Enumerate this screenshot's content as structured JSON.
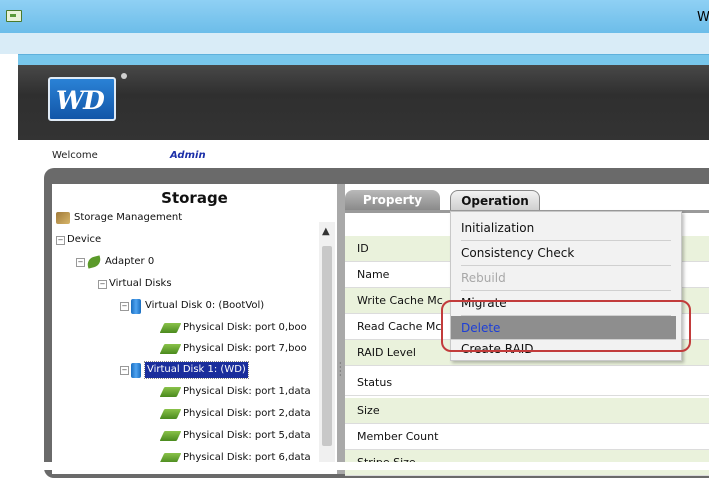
{
  "window": {
    "title": "W"
  },
  "brand": {
    "logo_text": "WD"
  },
  "welcome": {
    "label": "Welcome",
    "user": "Admin"
  },
  "storage": {
    "title": "Storage",
    "tree": [
      {
        "label": "Storage Management",
        "icon": "storage-management-icon"
      },
      {
        "label": "Device",
        "expander": "-"
      },
      {
        "label": "Adapter 0",
        "icon": "adapter-icon",
        "expander": "-"
      },
      {
        "label": "Virtual Disks"
      },
      {
        "label": "Virtual Disk 0: (BootVol)",
        "icon": "virtual-disk-icon",
        "expander": "-"
      },
      {
        "label": "Physical Disk: port 0,boo",
        "icon": "physical-disk-icon"
      },
      {
        "label": "Physical Disk: port 7,boo",
        "icon": "physical-disk-icon"
      },
      {
        "label": "Virtual Disk 1: (WD)",
        "icon": "virtual-disk-icon",
        "expander": "-",
        "selected": true
      },
      {
        "label": "Physical Disk: port 1,data",
        "icon": "physical-disk-icon"
      },
      {
        "label": "Physical Disk: port 2,data",
        "icon": "physical-disk-icon"
      },
      {
        "label": "Physical Disk: port 5,data",
        "icon": "physical-disk-icon"
      },
      {
        "label": "Physical Disk: port 6,data",
        "icon": "physical-disk-icon"
      }
    ]
  },
  "tabs": {
    "property": "Property",
    "operation": "Operation"
  },
  "properties": [
    "ID",
    "Name",
    "Write Cache Mc",
    "Read Cache Mc",
    "RAID Level",
    "Status",
    "Size",
    "Member Count",
    "Stripe Size"
  ],
  "operation_menu": {
    "items": [
      {
        "label": "Initialization",
        "state": "normal"
      },
      {
        "label": "Consistency Check",
        "state": "normal"
      },
      {
        "label": "Rebuild",
        "state": "disabled"
      },
      {
        "label": "Migrate",
        "state": "normal"
      },
      {
        "label": "Delete",
        "state": "highlighted"
      },
      {
        "label": "Create RAID",
        "state": "normal"
      }
    ]
  },
  "colors": {
    "accent_highlight": "#1d3fd6",
    "callout": "#c23b3b",
    "selection": "#1a2e9c"
  }
}
